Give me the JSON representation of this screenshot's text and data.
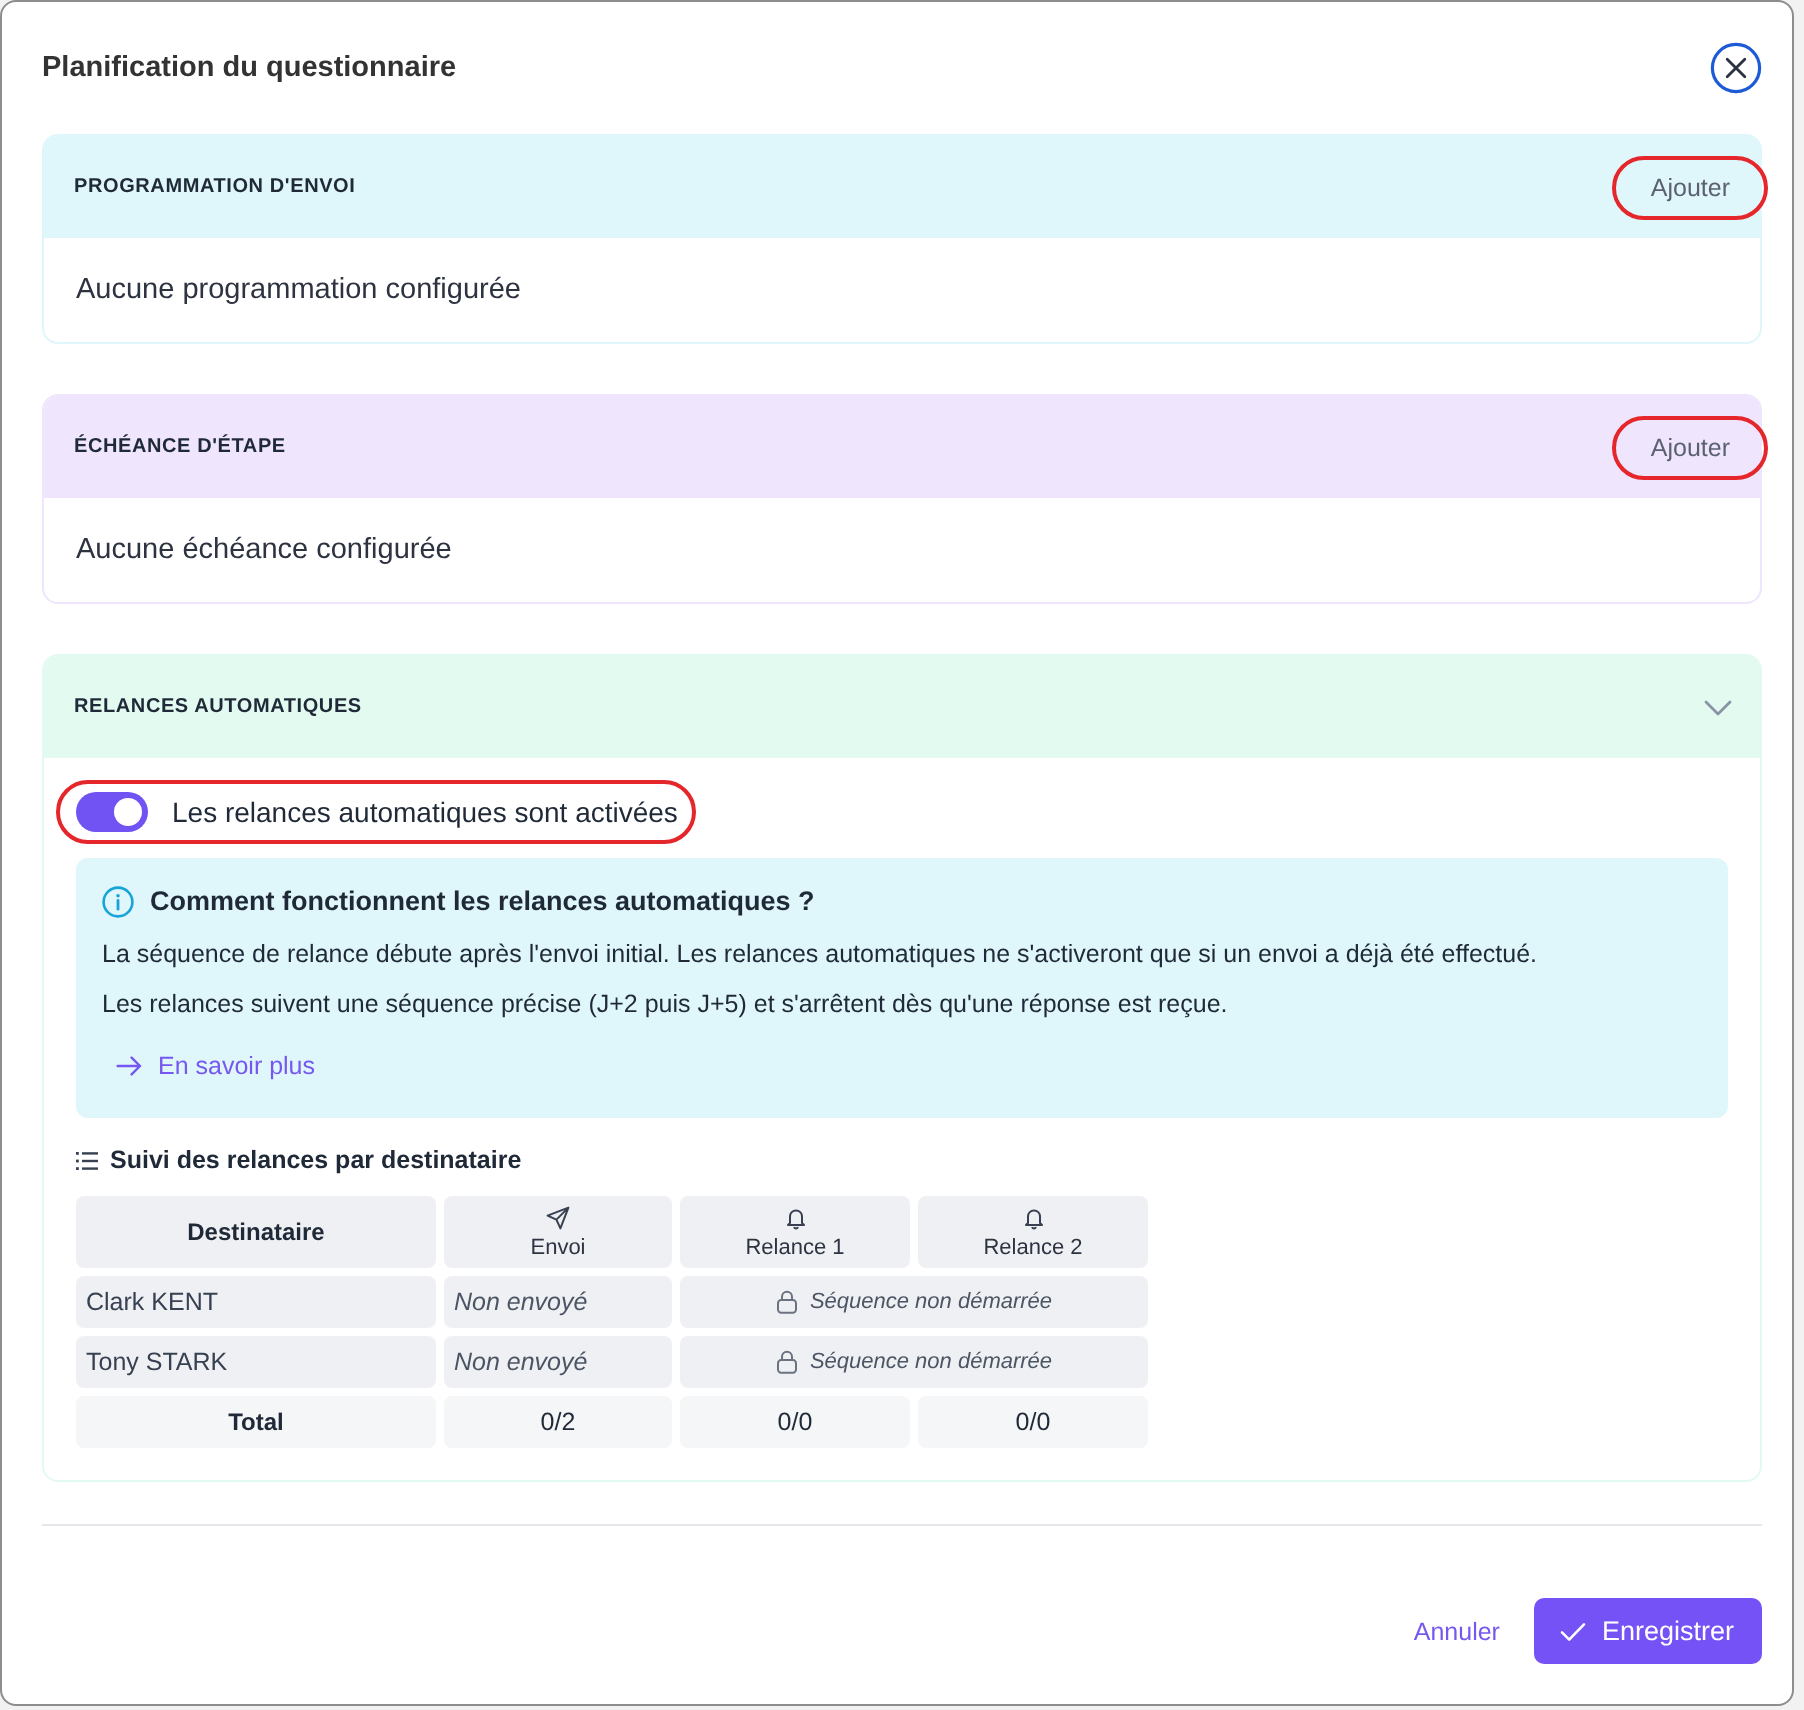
{
  "dialog": {
    "title": "Planification du questionnaire"
  },
  "sections": [
    {
      "kind": "empty",
      "title": "PROGRAMMATION D'ENVOI",
      "color": "#dff6fb",
      "action": {
        "label": "Ajouter",
        "highlighted": true
      },
      "empty_text": "Aucune programmation configurée"
    },
    {
      "kind": "empty",
      "title": "ÉCHÉANCE D'ÉTAPE",
      "color": "#efe6fd",
      "action": {
        "label": "Ajouter",
        "highlighted": true
      },
      "empty_text": "Aucune échéance configurée"
    },
    {
      "kind": "reminders",
      "title": "RELANCES AUTOMATIQUES",
      "color": "#e3faf1",
      "expanded": true,
      "toggle": {
        "label": "Les relances automatiques sont activées",
        "on": true,
        "highlighted": true
      },
      "info": {
        "title": "Comment fonctionnent les relances automatiques ?",
        "paragraphs": [
          "La séquence de relance débute après l'envoi initial. Les relances automatiques ne s'activeront que si un envoi a déjà été effectué.",
          "Les relances suivent une séquence précise (J+2 puis J+5) et s'arrêtent dès qu'une réponse est reçue."
        ],
        "link": "En savoir plus"
      },
      "tracking": {
        "title": "Suivi des relances par destinataire",
        "columns": [
          {
            "label": "Destinataire",
            "kind": "text"
          },
          {
            "label": "Envoi",
            "kind": "send"
          },
          {
            "label": "Relance 1",
            "kind": "reminder"
          },
          {
            "label": "Relance 2",
            "kind": "reminder"
          }
        ],
        "rows": [
          {
            "name": "Clark KENT",
            "send_status": "Non envoyé",
            "sequence_status": "Séquence non démarrée"
          },
          {
            "name": "Tony STARK",
            "send_status": "Non envoyé",
            "sequence_status": "Séquence non démarrée"
          }
        ],
        "total": {
          "label": "Total",
          "values": [
            "0/2",
            "0/0",
            "0/0"
          ]
        }
      }
    }
  ],
  "footer": {
    "cancel": "Annuler",
    "save": "Enregistrer"
  }
}
